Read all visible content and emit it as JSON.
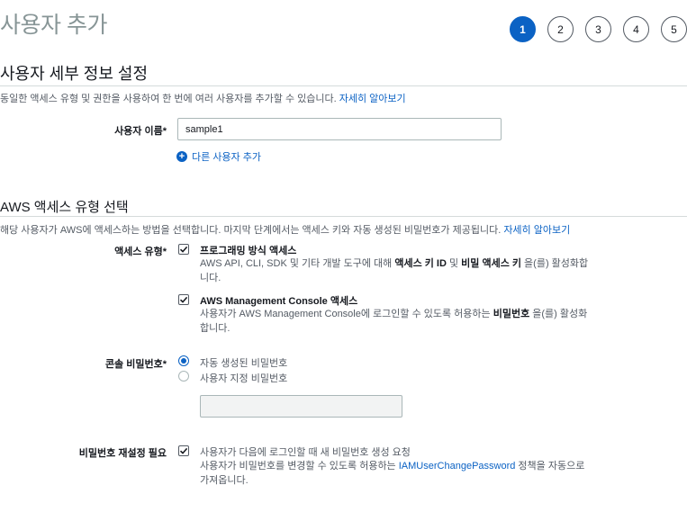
{
  "page": {
    "title": "사용자 추가"
  },
  "steps": [
    "1",
    "2",
    "3",
    "4",
    "5"
  ],
  "details": {
    "title": "사용자 세부 정보 설정",
    "description": "동일한 액세스 유형 및 권한을 사용하여 한 번에 여러 사용자를 추가할 수 있습니다.",
    "learn_more": "자세히 알아보기",
    "username_label": "사용자 이름*",
    "username_value": "sample1",
    "add_user_label": "다른 사용자 추가"
  },
  "access": {
    "title": "AWS 액세스 유형 선택",
    "description": "해당 사용자가 AWS에 액세스하는 방법을 선택합니다. 마지막 단계에서는 액세스 키와 자동 생성된 비밀번호가 제공됩니다.",
    "learn_more": "자세히 알아보기",
    "type_label": "액세스 유형*",
    "programmatic": {
      "title": "프로그래밍 방식 액세스",
      "desc_pre": "AWS API, CLI, SDK 및 기타 개발 도구에 대해 ",
      "desc_b1": "액세스 키 ID",
      "desc_mid": " 및 ",
      "desc_b2": "비밀 액세스 키",
      "desc_post": " 을(를) 활성화합니다."
    },
    "console": {
      "title": "AWS Management Console 액세스",
      "desc_pre": "사용자가 AWS Management Console에 로그인할 수 있도록 허용하는 ",
      "desc_b": "비밀번호",
      "desc_post": " 을(를) 활성화합니다."
    },
    "password_label": "콘솔 비밀번호*",
    "auto_password": "자동 생성된 비밀번호",
    "custom_password": "사용자 지정 비밀번호",
    "reset_label": "비밀번호 재설정 필요",
    "reset_text": "사용자가 다음에 로그인할 때 새 비밀번호 생성 요청",
    "reset_desc_pre": "사용자가 비밀번호를 변경할 수 있도록 허용하는 ",
    "reset_desc_link": "IAMUserChangePassword",
    "reset_desc_post": " 정책을 자동으로 가져옵니다."
  }
}
